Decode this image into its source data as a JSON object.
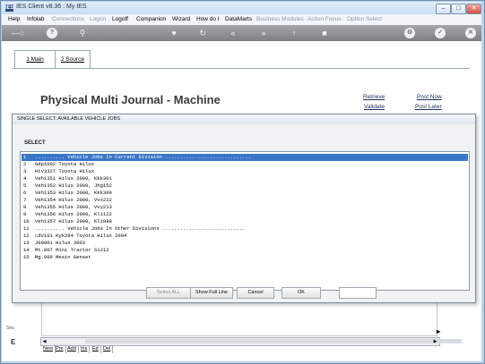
{
  "window": {
    "title": "IES Client v8.36 : My IES",
    "app_icon": "IES",
    "min": "–",
    "max": "□",
    "close": "✕"
  },
  "menu": [
    "Help",
    "Infolab",
    "Connections",
    "Logon",
    "Logoff",
    "Companion",
    "Wizard",
    "How do I",
    "DataMarts",
    "Business Modules",
    "Action Focus",
    "Option Select"
  ],
  "toolbar": {
    "icons": [
      "key-icon",
      "help-icon",
      "search-icon",
      "heart-icon",
      "refresh-icon",
      "back-icon",
      "forward-icon",
      "upload-icon",
      "stop-icon",
      "info-icon",
      "check-icon",
      "close-icon"
    ],
    "help_glyph": "?",
    "close_glyph": "✕"
  },
  "tabs": [
    {
      "label": "1 Main"
    },
    {
      "label": "2 Source"
    }
  ],
  "page": {
    "title": "Physical Multi Journal - Machine",
    "links": {
      "retrieve": "Retrieve",
      "validate": "Validate",
      "post_now": "Post Now",
      "post_later": "Post Later"
    }
  },
  "dialog": {
    "title": "SINGLE SELECT: AVAILABLE VEHICLE JOBS",
    "heading": "SELECT",
    "rows": [
      {
        "num": "1",
        "text": ".......... Vehicle Jobs In Current Division .............................",
        "selected": true
      },
      {
        "num": "2",
        "text": "Gdp1002 Toyota Hilux"
      },
      {
        "num": "3",
        "text": "Htv3327 Toyota Hilux"
      },
      {
        "num": "4",
        "text": "Veh1351 Hilux 2000, Kkk301"
      },
      {
        "num": "5",
        "text": "Veh1352 Hilux 2000, Jhg152"
      },
      {
        "num": "6",
        "text": "Veh1353 Hilux 2000, Kkk309"
      },
      {
        "num": "7",
        "text": "Veh1354 Hilux 2000, Vvx222"
      },
      {
        "num": "8",
        "text": "Veh1355 Hilux 2000, Vvy213"
      },
      {
        "num": "9",
        "text": "Veh1356 Hilux 2000, Kl1122"
      },
      {
        "num": "10",
        "text": "Veh1357 Hilux 2000, Kl1988"
      },
      {
        "num": "11",
        "text": ".......... Vehicle Jobs In Other Divisions ............................"
      },
      {
        "num": "12",
        "text": "Ldv101 Kyk294 Toyota Hilux 2004"
      },
      {
        "num": "13",
        "text": "J00001 Hilux 3003"
      },
      {
        "num": "14",
        "text": "Mt.007 Mini Tractor S1212"
      },
      {
        "num": "15",
        "text": "Mg.009 Mesin Genset"
      }
    ],
    "buttons": {
      "select_all": "Select ALL",
      "show_full_line": "Show Full Line",
      "cancel": "Cancel",
      "ok": "OK"
    }
  },
  "bottom": {
    "left_label_1": "Ses",
    "left_label_2": "E",
    "right_marker": "▸",
    "scroll_left": "◀",
    "scroll_right": "▶",
    "nav": [
      "New",
      "Pre",
      "Add",
      "Ins",
      "Ed",
      "Del"
    ]
  }
}
